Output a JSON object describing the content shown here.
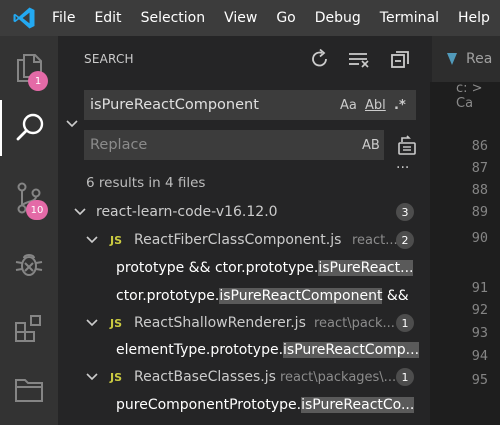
{
  "menu": [
    "File",
    "Edit",
    "Selection",
    "View",
    "Go",
    "Debug",
    "Terminal",
    "Help"
  ],
  "activity_badges": {
    "explorer": "1",
    "scm": "10"
  },
  "sidebar": {
    "title": "SEARCH",
    "search_value": "isPureReactComponent",
    "search_options": [
      "Aa",
      "Abl",
      ".*"
    ],
    "replace_placeholder": "Replace",
    "replace_option": "AB",
    "more": "···",
    "summary": "6 results in 4 files"
  },
  "results": {
    "folder": {
      "name": "react-learn-code-v16.12.0",
      "count": "3"
    },
    "files": [
      {
        "name": "ReactFiberClassComponent.js",
        "path": "react...",
        "count": "2",
        "matches": [
          {
            "before": "prototype && ctor.prototype.",
            "match": "isPureReact...",
            "after": ""
          },
          {
            "before": "ctor.prototype.",
            "match": "isPureReactComponent",
            "after": " &&"
          }
        ]
      },
      {
        "name": "ReactShallowRenderer.js",
        "path": "react\\pack...",
        "count": "1",
        "matches": [
          {
            "before": "elementType.prototype.",
            "match": "isPureReactComp...",
            "after": ""
          }
        ]
      },
      {
        "name": "ReactBaseClasses.js",
        "path": "react\\packages\\...",
        "count": "1",
        "matches": [
          {
            "before": "pureComponentPrototype.",
            "match": "isPureReactCo...",
            "after": ""
          }
        ]
      }
    ]
  },
  "editor": {
    "tab_label": "Rea",
    "breadcrumb": "c: > Ca",
    "line_numbers": [
      "86",
      "87",
      "88",
      "89",
      "90",
      "91",
      "92",
      "93",
      "94",
      "95"
    ]
  },
  "colors": {
    "accent": "#007acc",
    "badge": "#e46aa7",
    "highlight": "#5a5a5a"
  }
}
